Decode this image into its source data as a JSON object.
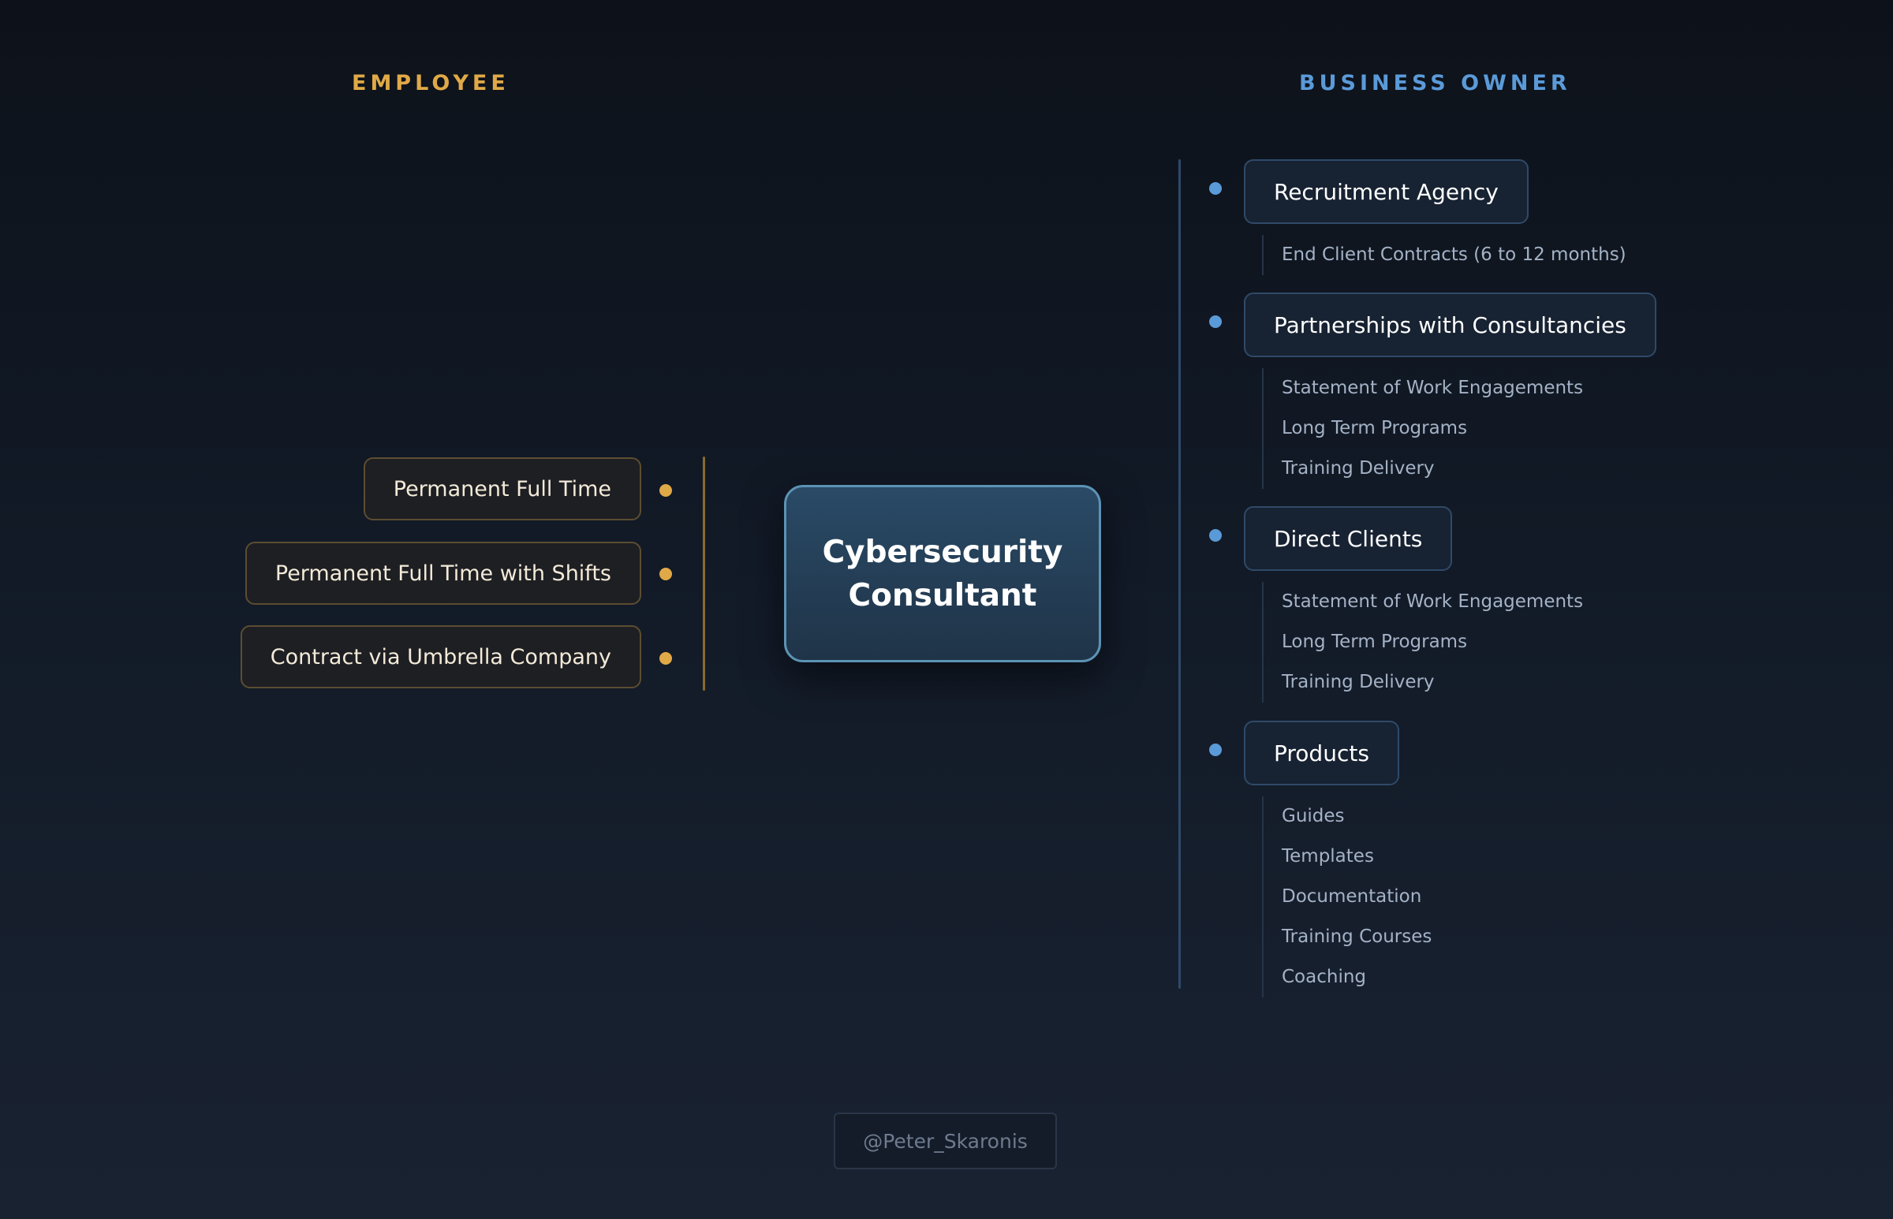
{
  "employee": {
    "heading": "EMPLOYEE",
    "accent_color": "#e0a947",
    "options": [
      "Permanent Full Time",
      "Permanent Full Time with Shifts",
      "Contract via Umbrella Company"
    ]
  },
  "center": {
    "title": "Cybersecurity Consultant",
    "border_color": "#5c93b5"
  },
  "business_owner": {
    "heading": "BUSINESS OWNER",
    "accent_color": "#5b9ad8",
    "groups": [
      {
        "label": "Recruitment Agency",
        "items": [
          "End Client Contracts (6 to 12 months)"
        ]
      },
      {
        "label": "Partnerships with Consultancies",
        "items": [
          "Statement of Work Engagements",
          "Long Term Programs",
          "Training Delivery"
        ]
      },
      {
        "label": "Direct Clients",
        "items": [
          "Statement of Work Engagements",
          "Long Term Programs",
          "Training Delivery"
        ]
      },
      {
        "label": "Products",
        "items": [
          "Guides",
          "Templates",
          "Documentation",
          "Training Courses",
          "Coaching"
        ]
      }
    ]
  },
  "credit": "@Peter_Skaronis"
}
